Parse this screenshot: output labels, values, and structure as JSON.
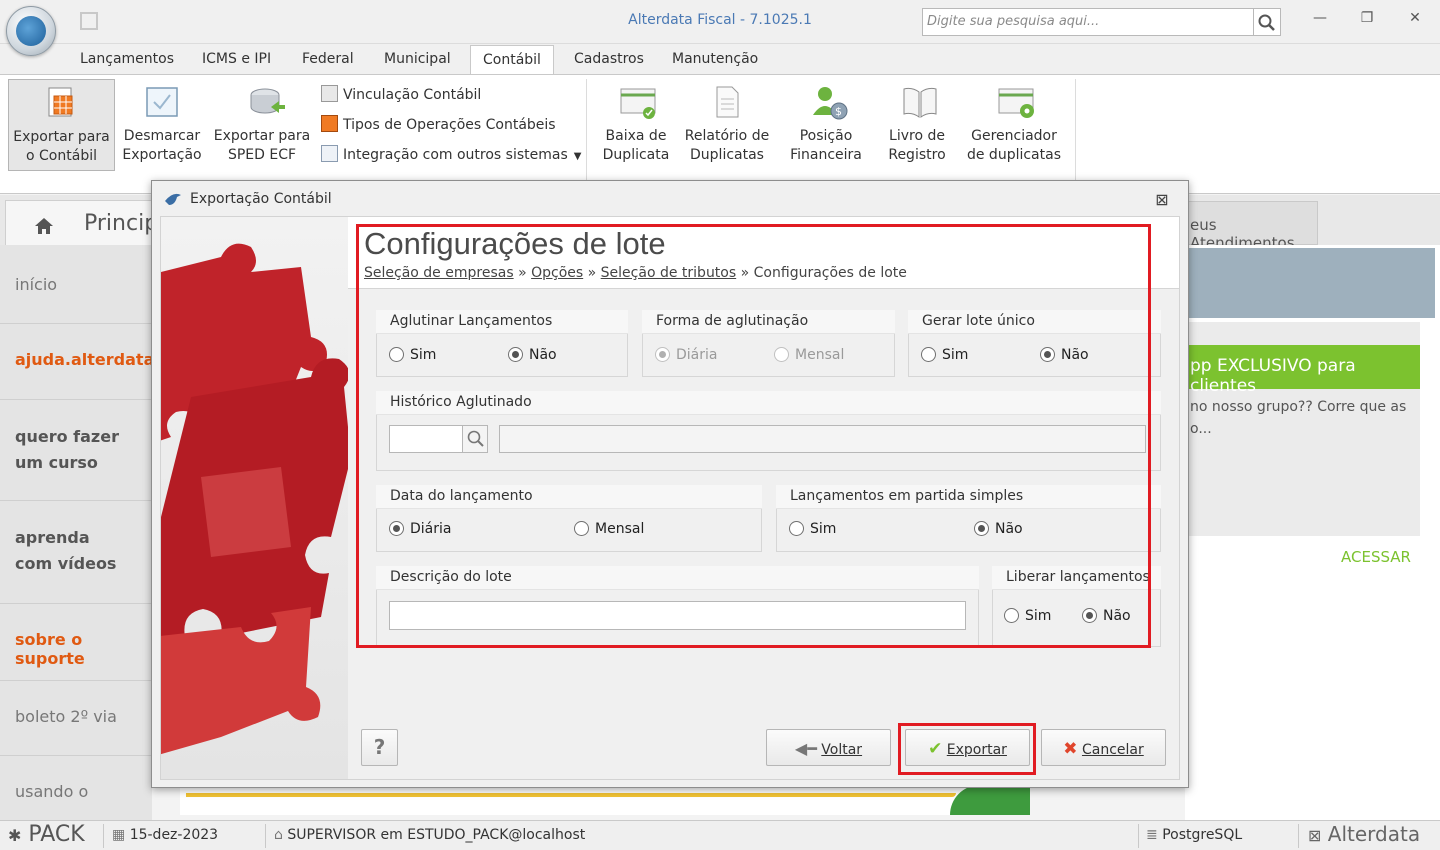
{
  "app": {
    "title": "Alterdata Fiscal - 7.1025.1",
    "search_placeholder": "Digite sua pesquisa aqui...",
    "window_controls": [
      "minimize-icon",
      "restore-icon",
      "close-icon"
    ]
  },
  "ribbon_tabs": [
    "Lançamentos",
    "ICMS e IPI",
    "Federal",
    "Municipal",
    "Contábil",
    "Cadastros",
    "Manutenção"
  ],
  "active_tab": "Contábil",
  "ribbon": {
    "export_contabil": "Exportar para\no Contábil",
    "unmark_export": "Desmarcar\nExportação",
    "export_sped": "Exportar para\nSPED ECF",
    "vinculacao": "Vinculação Contábil",
    "tipos_operacoes": "Tipos de Operações Contábeis",
    "integracao": "Integração com outros sistemas",
    "baixa_duplicata": "Baixa de\nDuplicata",
    "relatorio_duplicatas": "Relatório de\nDuplicatas",
    "posicao_financeira": "Posição\nFinanceira",
    "livro_registro": "Livro de\nRegistro",
    "gerenciador_duplicatas": "Gerenciador\nde duplicatas"
  },
  "background": {
    "home_tab": "Principa",
    "right_tab": "eus Atendimentos",
    "left_menu": [
      {
        "label": "início",
        "style": "gray"
      },
      {
        "label": "ajuda.alterdata.c",
        "style": "orange"
      },
      {
        "label": "quero fazer um curso",
        "style": "bold"
      },
      {
        "label": "aprenda com vídeos",
        "style": "bold"
      },
      {
        "label": "sobre o suporte",
        "style": "orange"
      },
      {
        "label": "boleto 2º via",
        "style": "gray"
      },
      {
        "label": "usando o",
        "style": "gray"
      }
    ],
    "promo_banner": "pp EXCLUSIVO para clientes",
    "promo_text": "no nosso grupo?? Corre que as o...",
    "promo_link": "ACESSAR"
  },
  "status": {
    "product": "PACK",
    "date": "15-dez-2023",
    "user": "SUPERVISOR em ESTUDO_PACK@localhost",
    "database": "PostgreSQL",
    "brand": "Alterdata"
  },
  "dialog": {
    "title": "Exportação Contábil",
    "page_title": "Configurações de lote",
    "breadcrumb": {
      "step1": "Seleção de empresas",
      "step2": "Opções",
      "step3": "Seleção de tributos",
      "current": "Configurações de lote",
      "separator": "»"
    },
    "groups": {
      "aglutinar": {
        "title": "Aglutinar Lançamentos",
        "opt1": "Sim",
        "opt2": "Não",
        "selected": "Não"
      },
      "forma": {
        "title": "Forma de aglutinação",
        "opt1": "Diária",
        "opt2": "Mensal",
        "selected": "Diária",
        "disabled": true
      },
      "lote_unico": {
        "title": "Gerar lote único",
        "opt1": "Sim",
        "opt2": "Não",
        "selected": "Não"
      },
      "historico": {
        "title": "Histórico Aglutinado",
        "code_value": "",
        "desc_value": ""
      },
      "data_lanc": {
        "title": "Data do lançamento",
        "opt1": "Diária",
        "opt2": "Mensal",
        "selected": "Diária"
      },
      "partida_simples": {
        "title": "Lançamentos em partida simples",
        "opt1": "Sim",
        "opt2": "Não",
        "selected": "Não"
      },
      "descricao": {
        "title": "Descrição do lote",
        "value": ""
      },
      "liberar": {
        "title": "Liberar lançamentos",
        "opt1": "Sim",
        "opt2": "Não",
        "selected": "Não"
      }
    },
    "buttons": {
      "help": "?",
      "back": "Voltar",
      "export": "Exportar",
      "cancel": "Cancelar"
    }
  },
  "colors": {
    "highlight": "#e11b22",
    "accent_blue": "#4a79b4",
    "green": "#7cc22f",
    "orange": "#e05a12"
  }
}
